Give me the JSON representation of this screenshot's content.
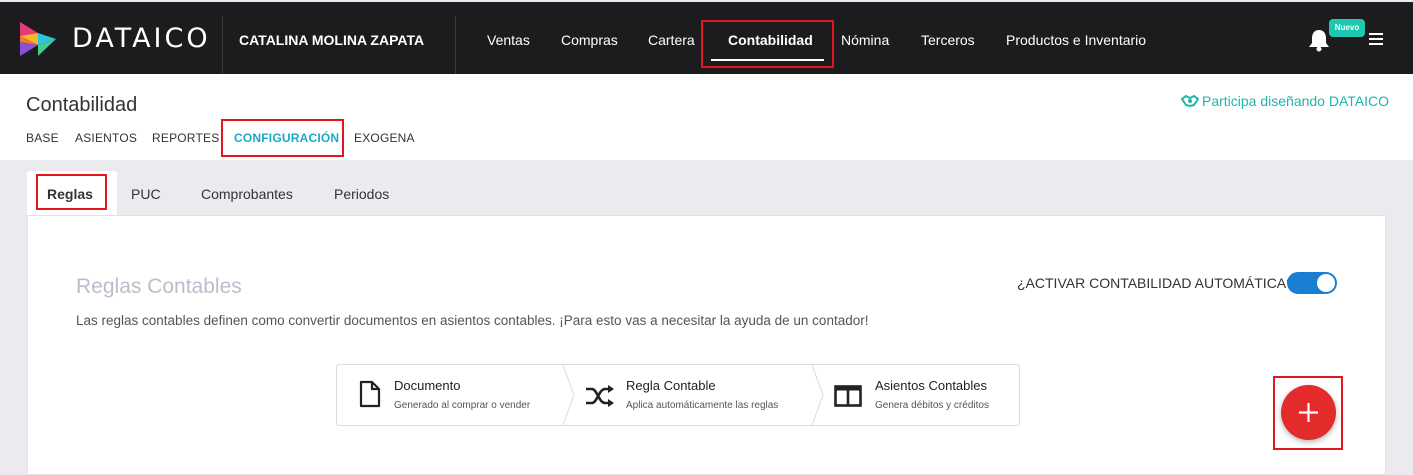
{
  "header": {
    "brand": "DATAICO",
    "company": "CATALINA MOLINA ZAPATA",
    "nav": [
      "Ventas",
      "Compras",
      "Cartera",
      "Contabilidad",
      "Nómina",
      "Terceros",
      "Productos e Inventario"
    ],
    "active_nav": "Contabilidad",
    "badge": "Nuevo"
  },
  "subheader": {
    "title": "Contabilidad",
    "participa": "Participa diseñando DATAICO",
    "tabs": [
      "BASE",
      "ASIENTOS",
      "REPORTES",
      "CONFIGURACIÓN",
      "EXOGENA"
    ],
    "active_tab": "CONFIGURACIÓN"
  },
  "content_tabs": {
    "items": [
      "Reglas",
      "PUC",
      "Comprobantes",
      "Periodos"
    ],
    "active": "Reglas"
  },
  "rules": {
    "title": "Reglas Contables",
    "description": "Las reglas contables definen como convertir documentos en asientos contables. ¡Para esto vas a necesitar la ayuda de un contador!",
    "auto_label": "¿ACTIVAR CONTABILIDAD AUTOMÁTICA?",
    "auto_enabled": true
  },
  "flow": [
    {
      "title": "Documento",
      "subtitle": "Generado al comprar o vender",
      "icon": "document-icon"
    },
    {
      "title": "Regla Contable",
      "subtitle": "Aplica automáticamente las reglas",
      "icon": "shuffle-icon"
    },
    {
      "title": "Asientos Contables",
      "subtitle": "Genera débitos y créditos",
      "icon": "columns-icon"
    }
  ],
  "colors": {
    "topbar": "#1c1c1e",
    "accent_teal": "#1fb5a8",
    "active_subtab": "#1aa9c9",
    "toggle_on": "#1a7ed3",
    "fab": "#e32b2b",
    "highlight": "#e0181e"
  }
}
